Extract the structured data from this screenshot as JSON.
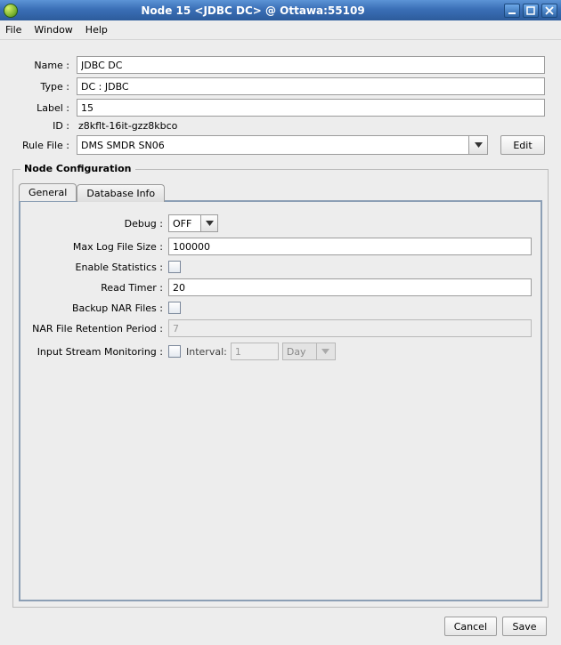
{
  "window": {
    "title": "Node 15 <JDBC DC> @ Ottawa:55109"
  },
  "menubar": {
    "file": "File",
    "window": "Window",
    "help": "Help"
  },
  "form": {
    "name_label": "Name :",
    "name_value": "JDBC DC",
    "type_label": "Type :",
    "type_value": "DC : JDBC",
    "label_label": "Label :",
    "label_value": "15",
    "id_label": "ID :",
    "id_value": "z8kflt-16it-gzz8kbco",
    "rulefile_label": "Rule File :",
    "rulefile_value": "DMS SMDR SN06",
    "edit_button": "Edit"
  },
  "node_config": {
    "legend": "Node Configuration",
    "tabs": {
      "general": "General",
      "database_info": "Database Info"
    },
    "fields": {
      "debug_label": "Debug :",
      "debug_value": "OFF",
      "maxlog_label": "Max Log File Size :",
      "maxlog_value": "100000",
      "enablestats_label": "Enable Statistics :",
      "readtimer_label": "Read Timer :",
      "readtimer_value": "20",
      "backup_label": "Backup NAR Files :",
      "retention_label": "NAR File Retention Period :",
      "retention_value": "7",
      "ism_label": "Input Stream Monitoring :",
      "ism_interval_label": "Interval:",
      "ism_interval_value": "1",
      "ism_unit_value": "Day"
    }
  },
  "footer": {
    "cancel": "Cancel",
    "save": "Save"
  }
}
